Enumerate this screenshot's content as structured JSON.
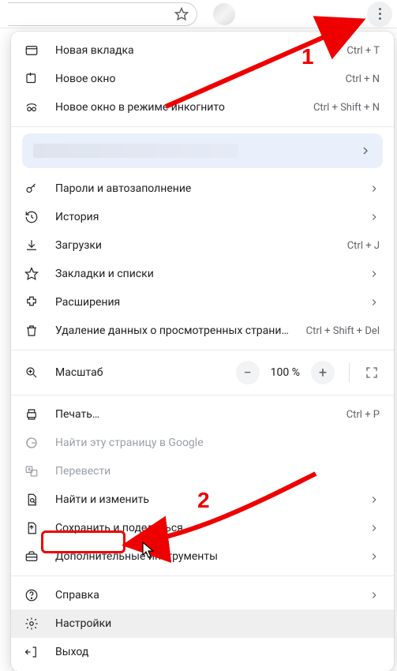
{
  "top": {
    "menu_button_name": "chrome-menu"
  },
  "annot": {
    "num1": "1",
    "num2": "2"
  },
  "menu": {
    "new_tab": {
      "label": "Новая вкладка",
      "shortcut": "Ctrl + T"
    },
    "new_window": {
      "label": "Новое окно",
      "shortcut": "Ctrl + N"
    },
    "incognito": {
      "label": "Новое окно в режиме инкогнито",
      "shortcut": "Ctrl + Shift + N"
    },
    "passwords": {
      "label": "Пароли и автозаполнение"
    },
    "history": {
      "label": "История"
    },
    "downloads": {
      "label": "Загрузки",
      "shortcut": "Ctrl + J"
    },
    "bookmarks": {
      "label": "Закладки и списки"
    },
    "extensions": {
      "label": "Расширения"
    },
    "clear_data": {
      "label": "Удаление данных о просмотренных страницах…",
      "shortcut": "Ctrl + Shift + Del"
    },
    "zoom": {
      "label": "Масштаб",
      "value": "100 %"
    },
    "print": {
      "label": "Печать…",
      "shortcut": "Ctrl + P"
    },
    "find_google": {
      "label": "Найти эту страницу в Google"
    },
    "translate": {
      "label": "Перевести"
    },
    "find_edit": {
      "label": "Найти и изменить"
    },
    "save_share": {
      "label": "Сохранить и поделиться"
    },
    "more_tools": {
      "label": "Дополнительные инструменты"
    },
    "help": {
      "label": "Справка"
    },
    "settings": {
      "label": "Настройки"
    },
    "exit": {
      "label": "Выход"
    }
  }
}
